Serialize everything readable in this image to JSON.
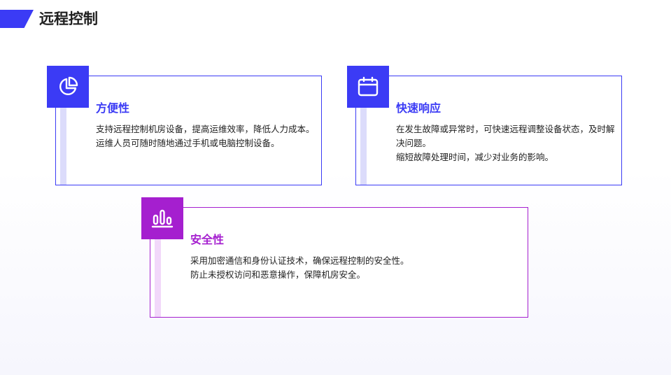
{
  "header": {
    "title": "远程控制"
  },
  "cards": [
    {
      "title": "方便性",
      "icon": "pie-chart-icon",
      "lines": [
        "支持远程控制机房设备，提高运维效率，降低人力成本。",
        "运维人员可随时随地通过手机或电脑控制设备。"
      ]
    },
    {
      "title": "快速响应",
      "icon": "calendar-icon",
      "lines": [
        "在发生故障或异常时，可快速远程调整设备状态，及时解决问题。",
        "缩短故障处理时间，减少对业务的影响。"
      ]
    },
    {
      "title": "安全性",
      "icon": "bar-chart-icon",
      "lines": [
        "采用加密通信和身份认证技术，确保远程控制的安全性。",
        "防止未授权访问和恶意操作，保障机房安全。"
      ]
    }
  ],
  "colors": {
    "primary": "#3b3bf5",
    "secondary": "#a51fcf"
  }
}
